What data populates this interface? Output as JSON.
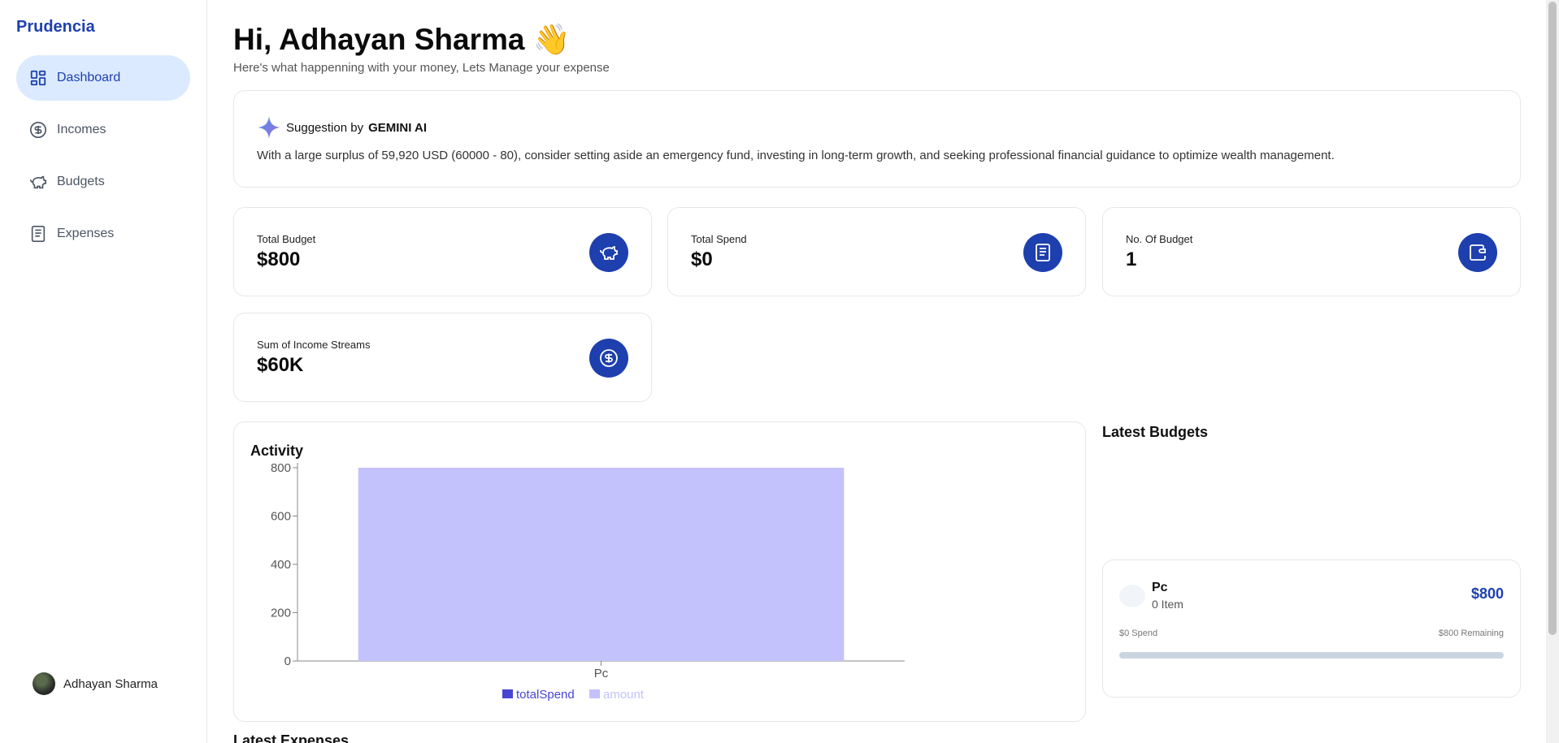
{
  "app": {
    "brand": "Prudencia"
  },
  "sidebar": {
    "items": [
      {
        "label": "Dashboard",
        "icon": "dashboard-icon",
        "active": true
      },
      {
        "label": "Incomes",
        "icon": "dollar-circle-icon",
        "active": false
      },
      {
        "label": "Budgets",
        "icon": "piggy-bank-icon",
        "active": false
      },
      {
        "label": "Expenses",
        "icon": "receipt-icon",
        "active": false
      }
    ],
    "user": {
      "name": "Adhayan Sharma"
    }
  },
  "header": {
    "greeting": "Hi, Adhayan Sharma 👋",
    "subtitle": "Here's what happenning with your money, Lets Manage your expense"
  },
  "suggestion": {
    "prefix": "Suggestion by ",
    "source": "GEMINI AI",
    "text": "With a large surplus of 59,920 USD (60000 - 80), consider setting aside an emergency fund, investing in long-term growth, and seeking professional financial guidance to optimize wealth management."
  },
  "stats": [
    {
      "label": "Total Budget",
      "value": "$800",
      "icon": "piggy-bank-icon"
    },
    {
      "label": "Total Spend",
      "value": "$0",
      "icon": "receipt-icon"
    },
    {
      "label": "No. Of Budget",
      "value": "1",
      "icon": "wallet-icon"
    },
    {
      "label": "Sum of Income Streams",
      "value": "$60K",
      "icon": "dollar-circle-icon"
    }
  ],
  "activity": {
    "title": "Activity"
  },
  "chart_data": {
    "type": "bar",
    "categories": [
      "Pc"
    ],
    "series": [
      {
        "name": "totalSpend",
        "values": [
          0
        ],
        "color": "#4845d2"
      },
      {
        "name": "amount",
        "values": [
          800
        ],
        "color": "#c3c2fc"
      }
    ],
    "stacked": true,
    "ylim": [
      0,
      800
    ],
    "yticks": [
      "0",
      "200",
      "400",
      "600",
      "800"
    ],
    "legend": "bottom",
    "grid": false
  },
  "latest_budgets": {
    "title": "Latest Budgets",
    "items": [
      {
        "name": "Pc",
        "items_label": "0 Item",
        "amount": "$800",
        "spend_label": "$0 Spend",
        "remaining_label": "$800 Remaining",
        "progress": 0
      }
    ]
  },
  "latest_expenses": {
    "title": "Latest Expenses"
  },
  "colors": {
    "accent": "#1e40af",
    "icon_bg": "#1e3fae",
    "active_nav_bg": "#dbeafe"
  }
}
